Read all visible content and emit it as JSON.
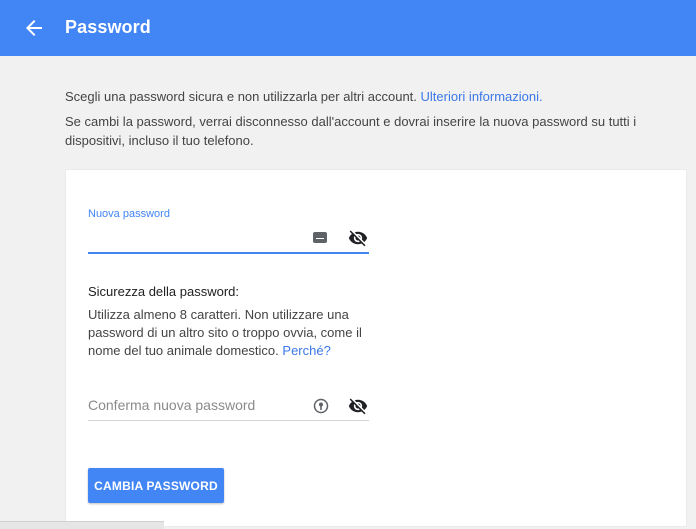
{
  "header": {
    "title": "Password",
    "background_color": "#4285f4"
  },
  "intro": {
    "line1_text": "Scegli una password sicura e non utilizzarla per altri account.",
    "line1_link": "Ulteriori informazioni.",
    "line2_text": "Se cambi la password, verrai disconnesso dall'account e dovrai inserire la nuova password su tutti i dispositivi, incluso il tuo telefono."
  },
  "form": {
    "new_password": {
      "label": "Nuova password",
      "value": ""
    },
    "strength": {
      "title": "Sicurezza della password:",
      "text": "Utilizza almeno 8 caratteri. Non utilizzare una password di un altro sito o troppo ovvia, come il nome del tuo animale domestico.",
      "link": "Perché?"
    },
    "confirm_password": {
      "placeholder": "Conferma nuova password",
      "value": ""
    },
    "submit_label": "CAMBIA PASSWORD"
  },
  "icons": {
    "back": "arrow-back-icon",
    "keyboard": "keyboard-icon",
    "key": "password-key-icon",
    "visibility": "visibility-off-icon"
  },
  "colors": {
    "accent": "#4285f4",
    "link": "#3b78e7"
  }
}
